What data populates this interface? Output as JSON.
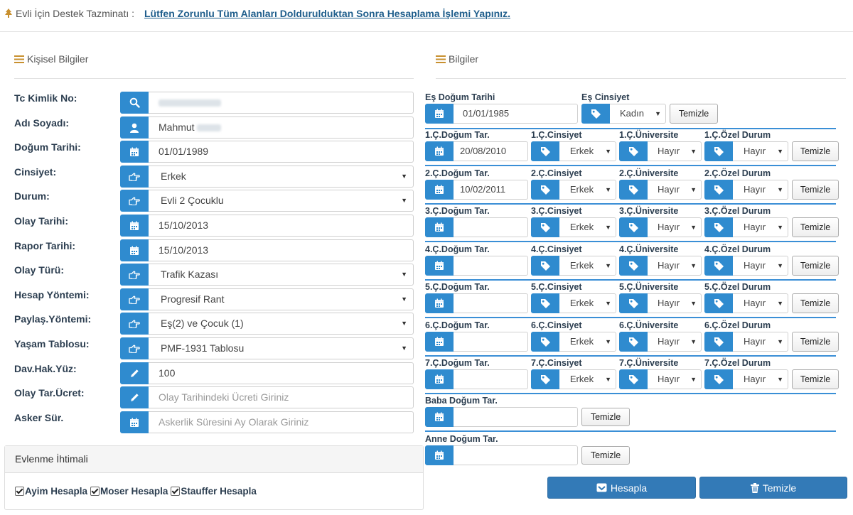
{
  "header": {
    "title": "Evli İçin Destek Tazminatı :",
    "notice": "Lütfen Zorunlu Tüm Alanları Doldurulduktan Sonra Hesaplama İşlemi Yapınız."
  },
  "left": {
    "section_title": "Kişisel Bilgiler",
    "fields": [
      {
        "label": "Tc Kimlik No:",
        "icon": "search-icon",
        "value": ""
      },
      {
        "label": "Adı Soyadı:",
        "icon": "user-icon",
        "value": "Mahmut"
      },
      {
        "label": "Doğum Tarihi:",
        "icon": "calendar-icon",
        "value": "01/01/1989"
      },
      {
        "label": "Cinsiyet:",
        "icon": "hand-point-icon",
        "value": "Erkek"
      },
      {
        "label": "Durum:",
        "icon": "hand-point-icon",
        "value": "Evli 2 Çocuklu"
      },
      {
        "label": "Olay Tarihi:",
        "icon": "calendar-icon",
        "value": "15/10/2013"
      },
      {
        "label": "Rapor Tarihi:",
        "icon": "calendar-icon",
        "value": "15/10/2013"
      },
      {
        "label": "Olay Türü:",
        "icon": "hand-point-icon",
        "value": "Trafik Kazası"
      },
      {
        "label": "Hesap Yöntemi:",
        "icon": "hand-point-icon",
        "value": "Progresif Rant"
      },
      {
        "label": "Paylaş.Yöntemi:",
        "icon": "hand-point-icon",
        "value": "Eş(2) ve Çocuk (1)"
      },
      {
        "label": "Yaşam Tablosu:",
        "icon": "hand-point-icon",
        "value": "PMF-1931 Tablosu"
      },
      {
        "label": "Dav.Hak.Yüz:",
        "icon": "pencil-icon",
        "value": "100"
      },
      {
        "label": "Olay Tar.Ücret:",
        "icon": "pencil-icon",
        "value": "",
        "placeholder": "Olay Tarihindeki Ücreti Giriniz"
      },
      {
        "label": "Asker Sür.",
        "icon": "calendar-icon",
        "value": "",
        "placeholder": "Askerlik Süresini Ay Olarak Giriniz"
      }
    ]
  },
  "marriage_panel": {
    "title": "Evlenme İhtimali",
    "checkboxes": [
      "Ayim Hesapla",
      "Moser Hesapla",
      "Stauffer Hesapla"
    ]
  },
  "right": {
    "section_title": "Bilgiler",
    "spouse": {
      "dob_label": "Eş Doğum Tarihi",
      "dob_value": "01/01/1985",
      "gender_label": "Eş Cinsiyet",
      "gender_value": "Kadın",
      "clear_label": "Temizle"
    },
    "children": [
      {
        "dob_label": "1.Ç.Doğum Tar.",
        "gender_label": "1.Ç.Cinsiyet",
        "uni_label": "1.Ç.Üniversite",
        "special_label": "1.Ç.Özel Durum",
        "dob": "20/08/2010",
        "gender": "Erkek",
        "uni": "Hayır",
        "special": "Hayır"
      },
      {
        "dob_label": "2.Ç.Doğum Tar.",
        "gender_label": "2.Ç.Cinsiyet",
        "uni_label": "2.Ç.Üniversite",
        "special_label": "2.Ç.Özel Durum",
        "dob": "10/02/2011",
        "gender": "Erkek",
        "uni": "Hayır",
        "special": "Hayır"
      },
      {
        "dob_label": "3.Ç.Doğum Tar.",
        "gender_label": "3.Ç.Cinsiyet",
        "uni_label": "3.Ç.Üniversite",
        "special_label": "3.Ç.Özel Durum",
        "dob": "",
        "gender": "Erkek",
        "uni": "Hayır",
        "special": "Hayır"
      },
      {
        "dob_label": "4.Ç.Doğum Tar.",
        "gender_label": "4.Ç.Cinsiyet",
        "uni_label": "4.Ç.Üniversite",
        "special_label": "4.Ç.Özel Durum",
        "dob": "",
        "gender": "Erkek",
        "uni": "Hayır",
        "special": "Hayır"
      },
      {
        "dob_label": "5.Ç.Doğum Tar.",
        "gender_label": "5.Ç.Cinsiyet",
        "uni_label": "5.Ç.Üniversite",
        "special_label": "5.Ç.Özel Durum",
        "dob": "",
        "gender": "Erkek",
        "uni": "Hayır",
        "special": "Hayır"
      },
      {
        "dob_label": "6.Ç.Doğum Tar.",
        "gender_label": "6.Ç.Cinsiyet",
        "uni_label": "6.Ç.Üniversite",
        "special_label": "6.Ç.Özel Durum",
        "dob": "",
        "gender": "Erkek",
        "uni": "Hayır",
        "special": "Hayır"
      },
      {
        "dob_label": "7.Ç.Doğum Tar.",
        "gender_label": "7.Ç.Cinsiyet",
        "uni_label": "7.Ç.Üniversite",
        "special_label": "7.Ç.Özel Durum",
        "dob": "",
        "gender": "Erkek",
        "uni": "Hayır",
        "special": "Hayır"
      }
    ],
    "child_clear_label": "Temizle",
    "father": {
      "label": "Baba Doğum Tar.",
      "value": "",
      "clear_label": "Temizle"
    },
    "mother": {
      "label": "Anne Doğum Tar.",
      "value": "",
      "clear_label": "Temizle"
    }
  },
  "actions": {
    "calculate_label": "Hesapla",
    "clear_label": "Temizle"
  },
  "colors": {
    "accent": "#2f8bcf",
    "primary_button": "#337ab7",
    "row_divider": "#3a8fd6",
    "label": "#2c3e50",
    "header_link": "#1f5e8c",
    "section_icon": "#c8902f"
  }
}
